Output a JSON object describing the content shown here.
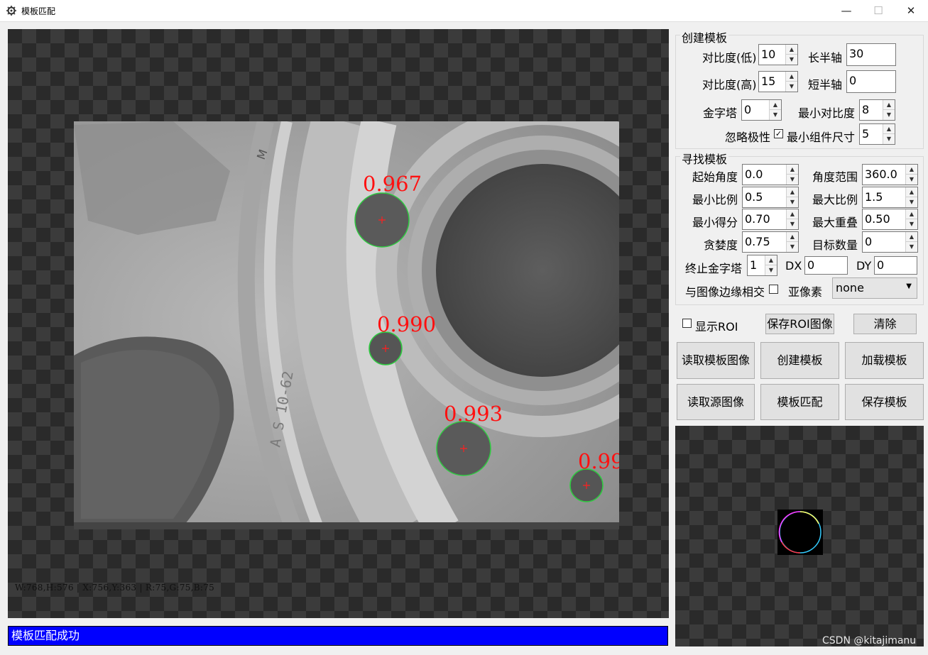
{
  "window": {
    "title": "模板匹配",
    "min": "—",
    "max": "☐",
    "close": "✕"
  },
  "viewer": {
    "info": "W:768,H:576 | X:756,Y:363 | R:75,G:75,B:75",
    "match_scores": [
      "0.967",
      "0.990",
      "0.993",
      "0.99"
    ]
  },
  "status": "模板匹配成功",
  "create": {
    "title": "创建模板",
    "contrast_low_label": "对比度(低)",
    "contrast_low": "10",
    "contrast_high_label": "对比度(高)",
    "contrast_high": "15",
    "major_axis_label": "长半轴",
    "major_axis": "30",
    "minor_axis_label": "短半轴",
    "minor_axis": "0",
    "pyramid_label": "金字塔",
    "pyramid": "0",
    "min_contrast_label": "最小对比度",
    "min_contrast": "8",
    "ignore_polarity_label": "忽略极性",
    "ignore_polarity_checked": true,
    "min_comp_label": "最小组件尺寸",
    "min_comp": "5"
  },
  "find": {
    "title": "寻找模板",
    "start_angle_label": "起始角度",
    "start_angle": "0.0",
    "angle_range_label": "角度范围",
    "angle_range": "360.0",
    "min_scale_label": "最小比例",
    "min_scale": "0.5",
    "max_scale_label": "最大比例",
    "max_scale": "1.5",
    "min_score_label": "最小得分",
    "min_score": "0.70",
    "max_overlap_label": "最大重叠",
    "max_overlap": "0.50",
    "greediness_label": "贪婪度",
    "greediness": "0.75",
    "num_targets_label": "目标数量",
    "num_targets": "0",
    "end_pyramid_label": "终止金字塔",
    "end_pyramid": "1",
    "dx_label": "DX",
    "dx": "0",
    "dy_label": "DY",
    "dy": "0",
    "intersect_label": "与图像边缘相交",
    "intersect_checked": false,
    "subpixel_label": "亚像素",
    "subpixel": "none"
  },
  "roi": {
    "show_label": "显示ROI",
    "show_checked": false,
    "save_label": "保存ROI图像",
    "clear_label": "清除"
  },
  "buttons": {
    "read_template": "读取模板图像",
    "create_template": "创建模板",
    "load_template": "加载模板",
    "read_source": "读取源图像",
    "match_template": "模板匹配",
    "save_template": "保存模板"
  },
  "watermark": "CSDN @kitajimanu"
}
